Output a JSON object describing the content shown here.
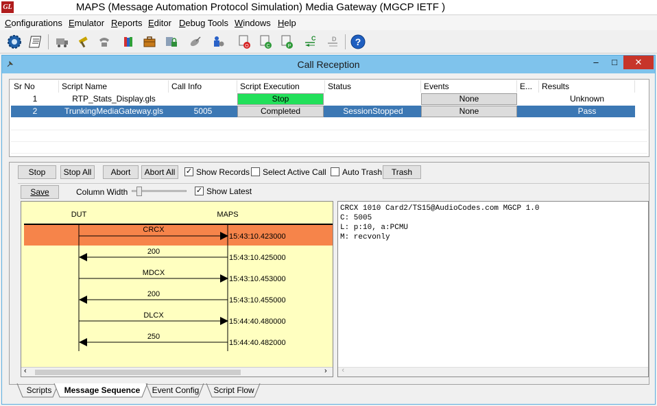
{
  "window": {
    "logo": "GL",
    "title": "MAPS (Message Automation Protocol Simulation) Media Gateway (MGCP IETF )"
  },
  "menu": [
    {
      "label": "Configurations",
      "accel": "C",
      "rest": "onfigurations"
    },
    {
      "label": "Emulator",
      "accel": "E",
      "rest": "mulator"
    },
    {
      "label": "Reports",
      "accel": "R",
      "rest": "eports"
    },
    {
      "label": "Editor",
      "accel": "E",
      "rest": "ditor"
    },
    {
      "label": "Debug Tools",
      "accel": "D",
      "rest": "ebug Tools"
    },
    {
      "label": "Windows",
      "accel": "W",
      "rest": "indows"
    },
    {
      "label": "Help",
      "accel": "H",
      "rest": "elp"
    }
  ],
  "child": {
    "title": "Call Reception",
    "minimize": "–",
    "maximize": "□",
    "close": "✕"
  },
  "table": {
    "headers": [
      "Sr No",
      "Script Name",
      "Call Info",
      "Script Execution",
      "Status",
      "Events",
      "E...",
      "Results"
    ],
    "rows": [
      {
        "sr": "1",
        "script": "RTP_Stats_Display.gls",
        "call_info": "",
        "execution": "Stop",
        "status": "",
        "events": "None",
        "e": "",
        "results": "Unknown",
        "selected": false
      },
      {
        "sr": "2",
        "script": "TrunkingMediaGateway.gls",
        "call_info": "5005",
        "execution": "Completed",
        "status": "SessionStopped",
        "events": "None",
        "e": "",
        "results": "Pass",
        "selected": true
      }
    ]
  },
  "controls": {
    "stop": "Stop",
    "stop_all": "Stop All",
    "abort": "Abort",
    "abort_all": "Abort All",
    "show_records": "Show Records",
    "show_records_checked": true,
    "select_active_call": "Select Active Call",
    "select_active_call_checked": false,
    "auto_trash": "Auto Trash",
    "auto_trash_checked": false,
    "trash": "Trash",
    "save": "Save",
    "column_width": "Column Width",
    "show_latest": "Show Latest",
    "show_latest_checked": true
  },
  "ladder": {
    "left_entity": "DUT",
    "right_entity": "MAPS",
    "messages": [
      {
        "label": "CRCX",
        "time": "15:43:10.423000",
        "direction": "right",
        "highlight": true
      },
      {
        "label": "200",
        "time": "15:43:10.425000",
        "direction": "left",
        "highlight": false
      },
      {
        "label": "MDCX",
        "time": "15:43:10.453000",
        "direction": "right",
        "highlight": false
      },
      {
        "label": "200",
        "time": "15:43:10.455000",
        "direction": "left",
        "highlight": false
      },
      {
        "label": "DLCX",
        "time": "15:44:40.480000",
        "direction": "right",
        "highlight": false
      },
      {
        "label": "250",
        "time": "15:44:40.482000",
        "direction": "left",
        "highlight": false
      }
    ]
  },
  "message_text": [
    "CRCX 1010 Card2/TS15@AudioCodes.com MGCP 1.0",
    "C: 5005",
    "L: p:10, a:PCMU",
    "M: recvonly"
  ],
  "tabs": [
    {
      "label": "Scripts",
      "active": false
    },
    {
      "label": "Message Sequence",
      "active": true
    },
    {
      "label": "Event Config",
      "active": false
    },
    {
      "label": "Script Flow",
      "active": false
    }
  ],
  "colors": {
    "title_blue": "#7fc3ec",
    "selected_row": "#3c78b4",
    "running_green": "#22e05a",
    "highlight_orange": "#f6844a",
    "ladder_bg": "#ffffc0"
  },
  "icons": [
    "gear-icon",
    "script-icon",
    "truck-icon",
    "hammer-icon",
    "phone-icon",
    "books-icon",
    "briefcase-icon",
    "lock-icon",
    "satellite-icon",
    "settings-man-icon",
    "record-o-icon",
    "record-c-icon",
    "record-p-icon",
    "call-chart-icon",
    "disabled-chart-icon",
    "help-icon"
  ]
}
